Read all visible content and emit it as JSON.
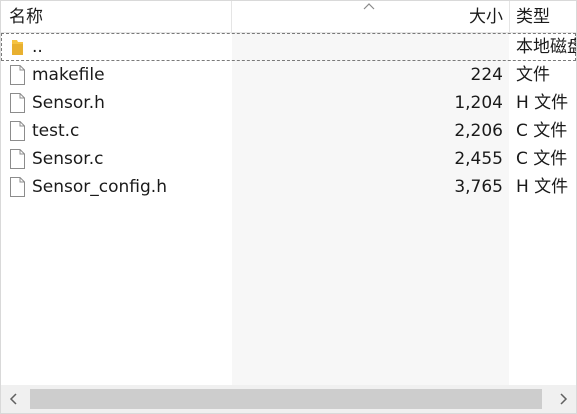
{
  "header": {
    "col_name": "名称",
    "col_size": "大小",
    "col_type": "类型"
  },
  "rows": [
    {
      "name": "..",
      "size": "",
      "type": "本地磁盘",
      "icon": "folder-icon"
    },
    {
      "name": "makefile",
      "size": "224",
      "type": "文件",
      "icon": "file-icon"
    },
    {
      "name": "Sensor.h",
      "size": "1,204",
      "type": "H 文件",
      "icon": "file-icon"
    },
    {
      "name": "test.c",
      "size": "2,206",
      "type": "C 文件",
      "icon": "file-icon"
    },
    {
      "name": "Sensor.c",
      "size": "2,455",
      "type": "C 文件",
      "icon": "file-icon"
    },
    {
      "name": "Sensor_config.h",
      "size": "3,765",
      "type": "H 文件",
      "icon": "file-icon"
    }
  ],
  "colors": {
    "sorted_column_bg": "#f7f7f7",
    "folder_yellow": "#f5c342",
    "scroll_thumb": "#cdcdcd"
  }
}
